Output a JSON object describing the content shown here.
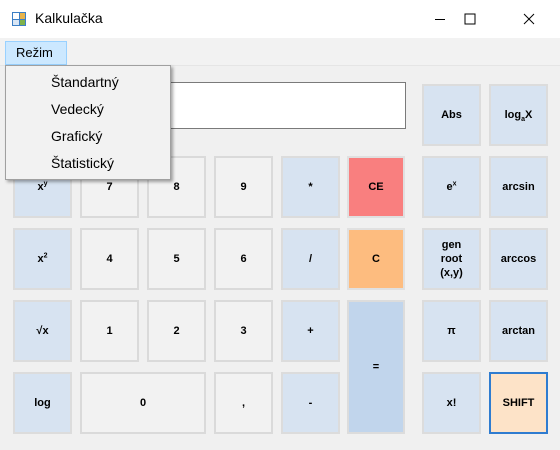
{
  "window": {
    "title": "Kalkulačka",
    "icon": "calculator-app-icon"
  },
  "menu": {
    "label": "Režim",
    "items": [
      "Štandartný",
      "Vedecký",
      "Grafický",
      "Štatistický"
    ]
  },
  "display": {
    "value": ""
  },
  "buttons": {
    "xy_base": "x",
    "xy_exp": "y",
    "x2_base": "x",
    "x2_exp": "2",
    "sqrt": "√x",
    "log": "log",
    "seven": "7",
    "eight": "8",
    "nine": "9",
    "four": "4",
    "five": "5",
    "six": "6",
    "one": "1",
    "two": "2",
    "three": "3",
    "zero": "0",
    "comma": ",",
    "multiply": "*",
    "divide": "/",
    "plus": "+",
    "minus": "-",
    "ce": "CE",
    "c": "C",
    "equals": "=",
    "abs": "Abs",
    "logax_pre": "log",
    "logax_sub": "a",
    "logax_post": "X",
    "ex_base": "e",
    "ex_exp": "x",
    "arcsin": "arcsin",
    "genroot_line1": "gen",
    "genroot_line2": "root",
    "genroot_line3": "(x,y)",
    "arccos": "arccos",
    "pi": "π",
    "arctan": "arctan",
    "factorial": "x!",
    "shift": "SHIFT"
  },
  "colors": {
    "ce": "#f97f7f",
    "c": "#fdbc7f",
    "equals": "#c1d5ec",
    "shift": "#fde3c8",
    "shift_border": "#2f7cd0",
    "function": "#dbe5f0",
    "digit": "#f2f2f2"
  }
}
